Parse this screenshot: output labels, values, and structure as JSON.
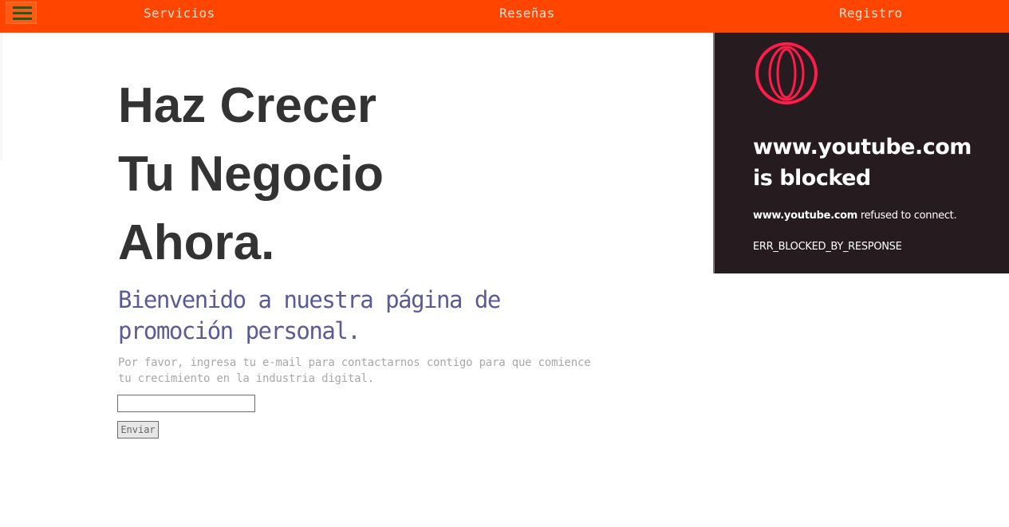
{
  "nav": {
    "menu_icon": "hamburger-menu-icon",
    "links": [
      "Servicios",
      "Reseñas",
      "Registro"
    ]
  },
  "hero": {
    "title_lines": [
      "Haz Crecer",
      "Tu Negocio",
      "Ahora."
    ],
    "subtitle": "Bienvenido a nuestra página de promoción personal.",
    "description": "Por favor, ingresa tu e-mail para contactarnos contigo para que comience tu crecimiento en la industria digital."
  },
  "form": {
    "email_value": "",
    "submit_label": "Enviar"
  },
  "embed": {
    "logo_icon": "opera-logo-icon",
    "title_host": "www.youtube.com",
    "title_rest": "is blocked",
    "message_host": "www.youtube.com",
    "message_rest": " refused to connect.",
    "error_code": "ERR_BLOCKED_BY_RESPONSE"
  },
  "colors": {
    "nav_bg": "#ff4500",
    "title": "#333333",
    "subtitle": "#5a5a96",
    "embed_bg": "#261b1f",
    "logo": "#ff1b4a"
  }
}
